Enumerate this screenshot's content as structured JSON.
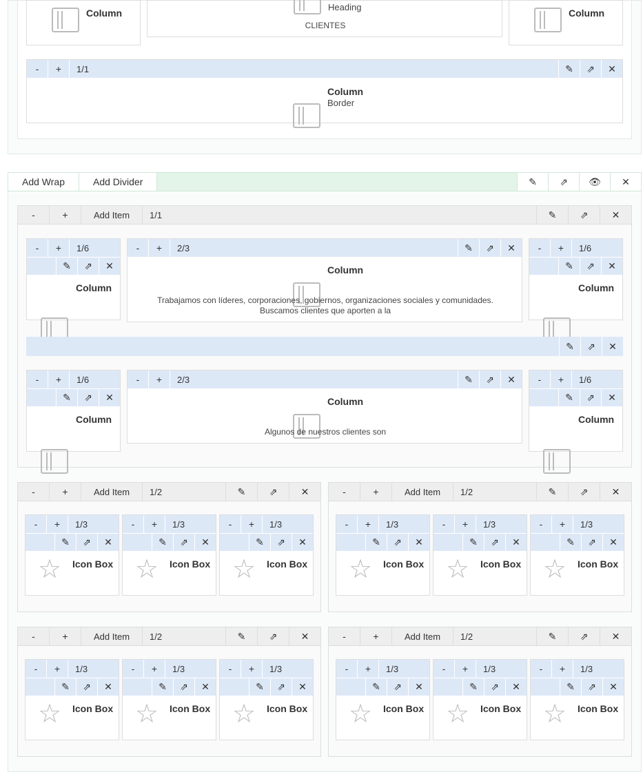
{
  "top": {
    "col_left": "Column",
    "heading_title": "Heading",
    "heading_text": "CLIENTES",
    "col_right": "Column",
    "row": {
      "minus": "-",
      "plus": "+",
      "size": "1/1",
      "title": "Column",
      "sub": "Border"
    }
  },
  "wrap": {
    "add_wrap": "Add Wrap",
    "add_divider": "Add Divider"
  },
  "item": {
    "minus": "-",
    "plus": "+",
    "add_item": "Add Item",
    "size": "1/1"
  },
  "row1": {
    "left": {
      "size": "1/6",
      "title": "Column"
    },
    "mid": {
      "size": "2/3",
      "title": "Column",
      "text": "Trabajamos con líderes, corporaciones, gobiernos, organizaciones sociales y comunidades. Buscamos clientes que aporten a la"
    },
    "right": {
      "size": "1/6",
      "title": "Column"
    }
  },
  "row2": {
    "left": {
      "size": "1/6",
      "title": "Column"
    },
    "mid": {
      "size": "2/3",
      "title": "Column",
      "text": "Algunos de nuestros clientes son"
    },
    "right": {
      "size": "1/6",
      "title": "Column"
    }
  },
  "half_size": "1/2",
  "third_size": "1/3",
  "iconbox": "Icon Box",
  "glyphs": {
    "minus": "-",
    "plus": "+",
    "pencil": "✎",
    "share": "⇗",
    "close": "✕",
    "eye": "👁",
    "star": "☆"
  },
  "icons": [
    "pencil-icon",
    "share-icon",
    "close-icon",
    "eye-icon",
    "star-icon",
    "column-icon"
  ]
}
